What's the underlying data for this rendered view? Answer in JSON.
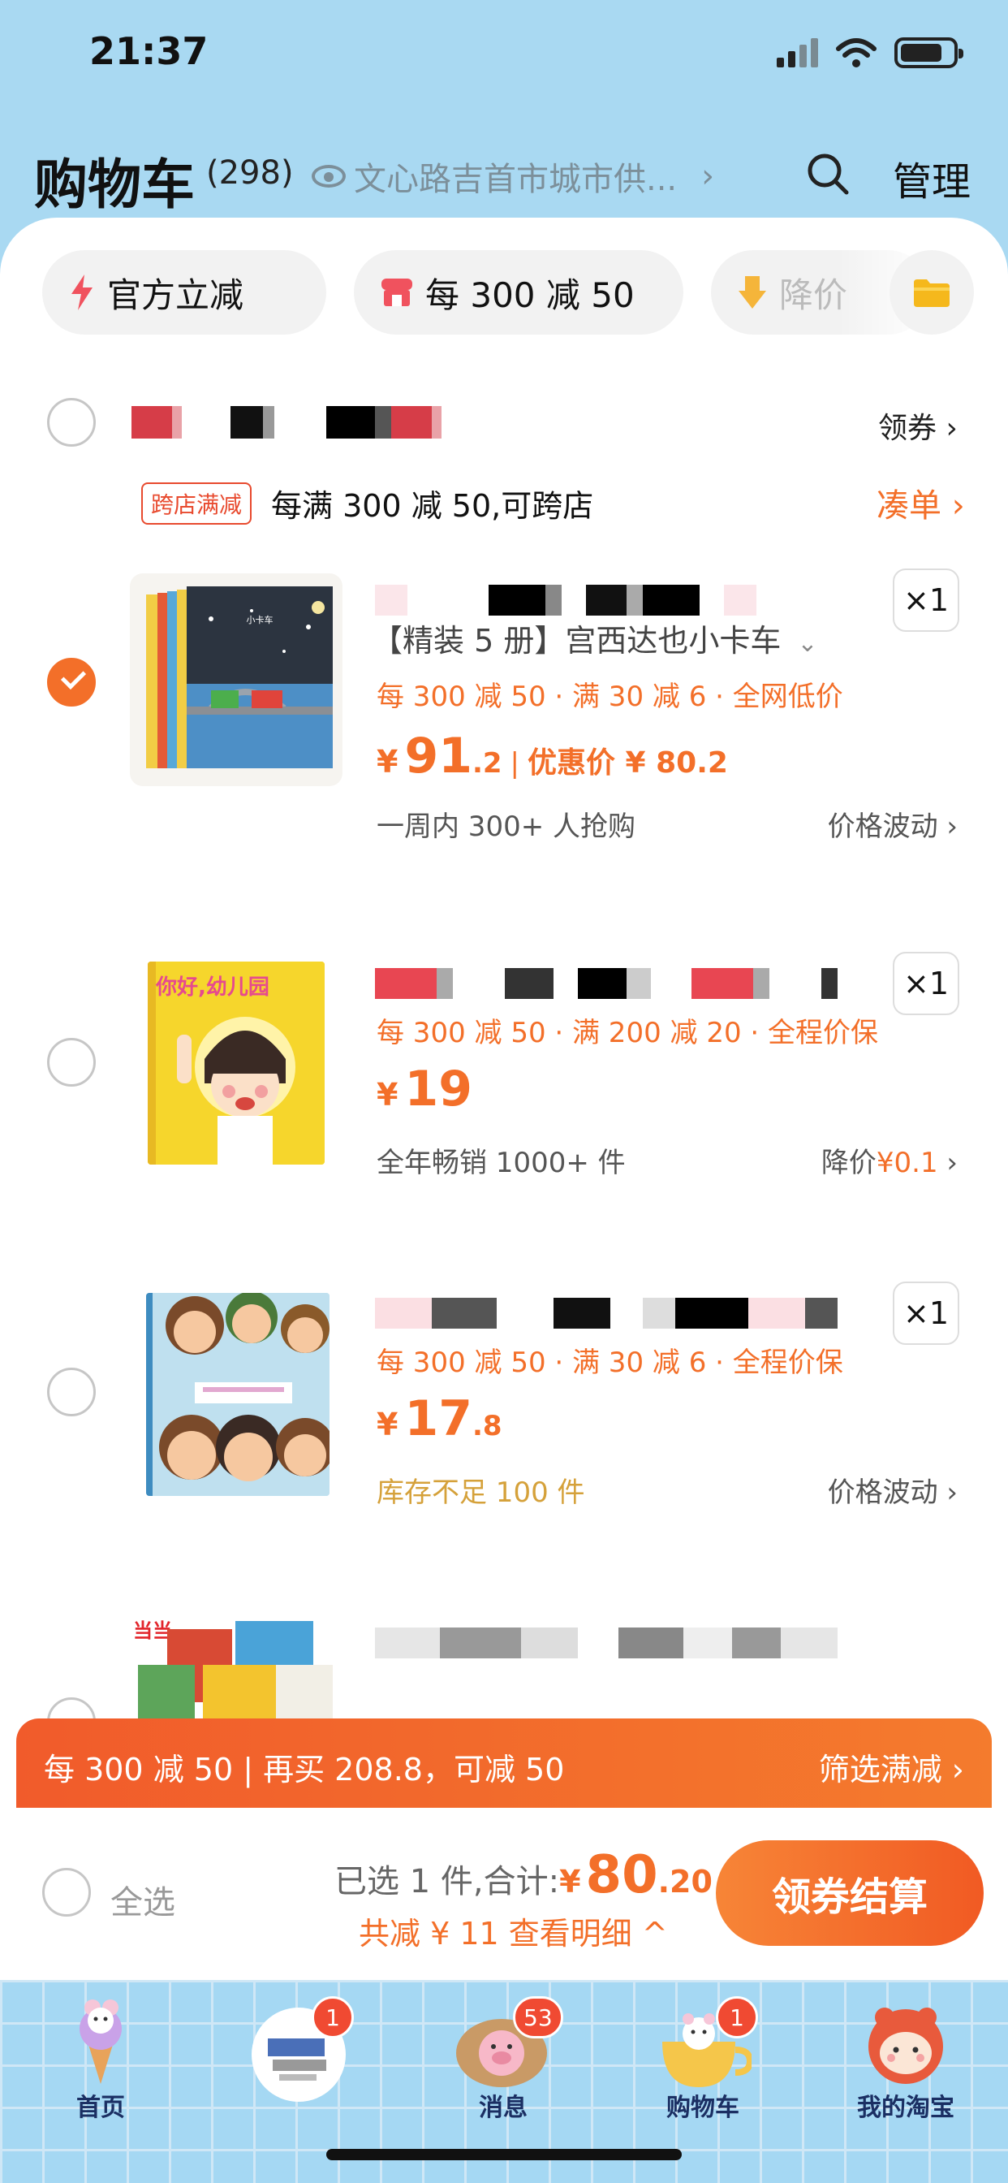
{
  "status_bar": {
    "time": "21:37"
  },
  "header": {
    "title": "购物车",
    "count": "(298)",
    "location": "文心路吉首市城市供...",
    "location_chevron": "›",
    "manage_label": "管理"
  },
  "filter_chips": [
    {
      "icon": "lightning-icon",
      "label": "官方立减"
    },
    {
      "icon": "shop-icon",
      "label": "每 300 减 50"
    },
    {
      "icon": "price-drop-icon",
      "label": "降价"
    }
  ],
  "shop": {
    "coupon_label": "领券 ›",
    "promo_tag": "跨店满减",
    "promo_text": "每满 300 减 50,可跨店",
    "promo_link": "凑单 ›"
  },
  "items": [
    {
      "spec": "【精装 5 册】宫西达也小卡车",
      "spec_arrow": "⌄",
      "qty": "×1",
      "tags": "每 300 减 50 · 满 30 减 6 · 全网低价",
      "price_yen": "¥",
      "price_int": "91",
      "price_dec": ".2",
      "price_sep": "|",
      "discount": "优惠价 ¥ 80.2",
      "meta_left": "一周内 300+ 人抢购",
      "meta_right": "价格波动 ›",
      "checked": true
    },
    {
      "qty": "×1",
      "tags": "每 300 减 50 · 满 200 减 20 · 全程价保",
      "price_yen": "¥",
      "price_int": "19",
      "price_dec": "",
      "meta_left": "全年畅销 1000+ 件",
      "meta_right_prefix": "降价",
      "meta_right_value": "¥0.1",
      "meta_right_suffix": " ›",
      "checked": false
    },
    {
      "qty": "×1",
      "tags": "每 300 减 50 · 满 30 减 6 · 全程价保",
      "price_yen": "¥",
      "price_int": "17",
      "price_dec": ".8",
      "meta_left": "库存不足 100 件",
      "meta_right": "价格波动 ›",
      "checked": false
    }
  ],
  "banner": {
    "left": "每 300 减 50 | 再买 208.8，可减 50",
    "right": "筛选满减 ›"
  },
  "checkout": {
    "select_all": "全选",
    "selected_text": "已选 1 件,合计: ",
    "total_yen": "¥",
    "total_int": "80",
    "total_dec": ".20",
    "savings": "共减 ¥ 11  查看明细 ^",
    "pay_button": "领券结算"
  },
  "tabbar": [
    {
      "label": "首页",
      "badge": ""
    },
    {
      "label": "",
      "badge": "1"
    },
    {
      "label": "消息",
      "badge": "53"
    },
    {
      "label": "购物车",
      "badge": "1"
    },
    {
      "label": "我的淘宝",
      "badge": ""
    }
  ],
  "colors": {
    "accent": "#f36f29",
    "tab_bg": "#a5d8f3",
    "header_bg": "#a9d9f2"
  }
}
